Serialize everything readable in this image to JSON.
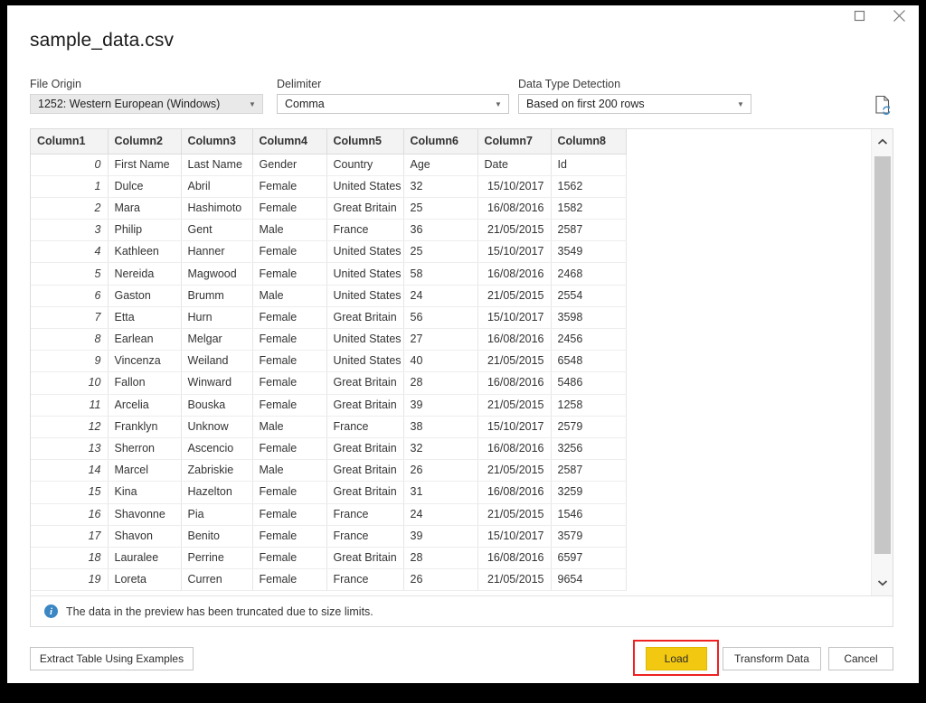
{
  "window": {
    "title": "sample_data.csv",
    "controls": [
      {
        "name": "maximize",
        "label": "☐"
      },
      {
        "name": "close",
        "label": "✕"
      }
    ]
  },
  "options": {
    "file_origin": {
      "label": "File Origin",
      "value": "1252: Western European (Windows)"
    },
    "delimiter": {
      "label": "Delimiter",
      "value": "Comma"
    },
    "data_type_detection": {
      "label": "Data Type Detection",
      "value": "Based on first 200 rows"
    },
    "refresh_icon": "document-refresh-icon"
  },
  "preview": {
    "columns": [
      "Column1",
      "Column2",
      "Column3",
      "Column4",
      "Column5",
      "Column6",
      "Column7",
      "Column8"
    ],
    "rows": [
      [
        "0",
        "First Name",
        "Last Name",
        "Gender",
        "Country",
        "Age",
        "Date",
        "Id"
      ],
      [
        "1",
        "Dulce",
        "Abril",
        "Female",
        "United States",
        "32",
        "15/10/2017",
        "1562"
      ],
      [
        "2",
        "Mara",
        "Hashimoto",
        "Female",
        "Great Britain",
        "25",
        "16/08/2016",
        "1582"
      ],
      [
        "3",
        "Philip",
        "Gent",
        "Male",
        "France",
        "36",
        "21/05/2015",
        "2587"
      ],
      [
        "4",
        "Kathleen",
        "Hanner",
        "Female",
        "United States",
        "25",
        "15/10/2017",
        "3549"
      ],
      [
        "5",
        "Nereida",
        "Magwood",
        "Female",
        "United States",
        "58",
        "16/08/2016",
        "2468"
      ],
      [
        "6",
        "Gaston",
        "Brumm",
        "Male",
        "United States",
        "24",
        "21/05/2015",
        "2554"
      ],
      [
        "7",
        "Etta",
        "Hurn",
        "Female",
        "Great Britain",
        "56",
        "15/10/2017",
        "3598"
      ],
      [
        "8",
        "Earlean",
        "Melgar",
        "Female",
        "United States",
        "27",
        "16/08/2016",
        "2456"
      ],
      [
        "9",
        "Vincenza",
        "Weiland",
        "Female",
        "United States",
        "40",
        "21/05/2015",
        "6548"
      ],
      [
        "10",
        "Fallon",
        "Winward",
        "Female",
        "Great Britain",
        "28",
        "16/08/2016",
        "5486"
      ],
      [
        "11",
        "Arcelia",
        "Bouska",
        "Female",
        "Great Britain",
        "39",
        "21/05/2015",
        "1258"
      ],
      [
        "12",
        "Franklyn",
        "Unknow",
        "Male",
        "France",
        "38",
        "15/10/2017",
        "2579"
      ],
      [
        "13",
        "Sherron",
        "Ascencio",
        "Female",
        "Great Britain",
        "32",
        "16/08/2016",
        "3256"
      ],
      [
        "14",
        "Marcel",
        "Zabriskie",
        "Male",
        "Great Britain",
        "26",
        "21/05/2015",
        "2587"
      ],
      [
        "15",
        "Kina",
        "Hazelton",
        "Female",
        "Great Britain",
        "31",
        "16/08/2016",
        "3259"
      ],
      [
        "16",
        "Shavonne",
        "Pia",
        "Female",
        "France",
        "24",
        "21/05/2015",
        "1546"
      ],
      [
        "17",
        "Shavon",
        "Benito",
        "Female",
        "France",
        "39",
        "15/10/2017",
        "3579"
      ],
      [
        "18",
        "Lauralee",
        "Perrine",
        "Female",
        "Great Britain",
        "28",
        "16/08/2016",
        "6597"
      ],
      [
        "19",
        "Loreta",
        "Curren",
        "Female",
        "France",
        "26",
        "21/05/2015",
        "9654"
      ]
    ],
    "info_message": "The data in the preview has been truncated due to size limits.",
    "info_icon": "info-icon",
    "scrollbar": {
      "up_arrow": "chevron-up-icon",
      "down_arrow": "chevron-down-icon"
    }
  },
  "footer": {
    "extract_table": "Extract Table Using Examples",
    "load": "Load",
    "transform_data": "Transform Data",
    "cancel": "Cancel"
  },
  "colors": {
    "accent": "#f2c811",
    "highlight": "#ee2222",
    "info": "#3b87c4",
    "header_bg": "#f3f3f3"
  }
}
